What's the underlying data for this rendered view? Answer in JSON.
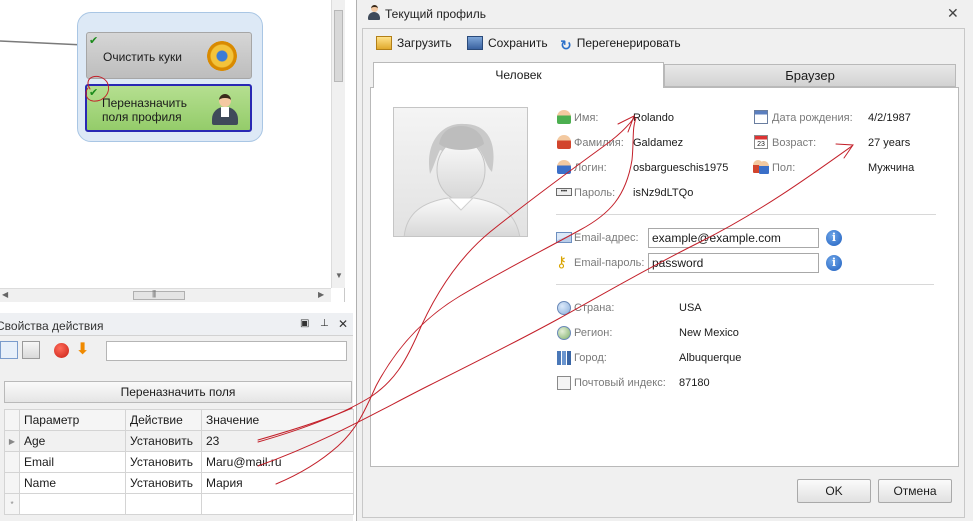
{
  "workflow": {
    "node_clear": {
      "label": "Очистить куки"
    },
    "node_reassign": {
      "label": "Переназначить поля профиля"
    }
  },
  "properties": {
    "title": "Свойства действия",
    "reassign_button": "Переназначить поля",
    "columns": [
      "Параметр",
      "Действие",
      "Значение"
    ],
    "rows": [
      {
        "param": "Age",
        "action": "Установить",
        "value": "23"
      },
      {
        "param": "Email",
        "action": "Установить",
        "value": "Maru@mail.ru"
      },
      {
        "param": "Name",
        "action": "Установить",
        "value": "Мария"
      }
    ],
    "new_row_marker": "*"
  },
  "dialog": {
    "title": "Текущий профиль",
    "toolbar": {
      "load": "Загрузить",
      "save": "Сохранить",
      "regenerate": "Перегенерировать"
    },
    "tabs": {
      "person": "Человек",
      "browser": "Браузер"
    },
    "fields": {
      "name": {
        "label": "Имя:",
        "value": "Rolando"
      },
      "surname": {
        "label": "Фамилия:",
        "value": "Galdamez"
      },
      "login": {
        "label": "Логин:",
        "value": "osbargueschis1975"
      },
      "password": {
        "label": "Пароль:",
        "value": "isNz9dLTQo"
      },
      "birth": {
        "label": "Дата рождения:",
        "value": "4/2/1987"
      },
      "age": {
        "label": "Возраст:",
        "value": "27 years"
      },
      "sex": {
        "label": "Пол:",
        "value": "Мужчина"
      },
      "email": {
        "label": "Email-адрес:",
        "value": "example@example.com"
      },
      "email_pass": {
        "label": "Email-пароль:",
        "value": "password"
      },
      "country": {
        "label": "Страна:",
        "value": "USA"
      },
      "region": {
        "label": "Регион:",
        "value": "New Mexico"
      },
      "city": {
        "label": "Город:",
        "value": "Albuquerque"
      },
      "zip": {
        "label": "Почтовый индекс:",
        "value": "87180"
      }
    },
    "ok": "OK",
    "cancel": "Отмена"
  }
}
